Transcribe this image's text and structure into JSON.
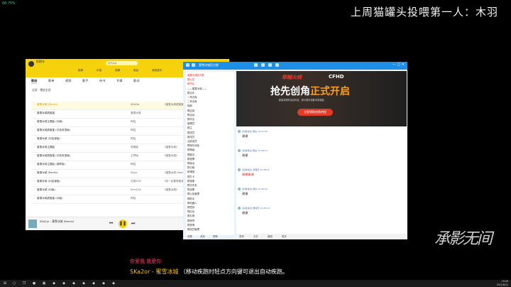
{
  "overlay": {
    "fps": "60 FPS",
    "banner": "上周猫罐头投喂第一人：木羽",
    "subtitle_line1": "你爱我 我爱你",
    "subtitle_song": "SKa2or - 蜜雪冰城",
    "subtitle_tip": "（移动疾跑时轻点方向键可退出自动疾跑。",
    "watermark": "承影无间"
  },
  "music": {
    "user": "斯斯咔",
    "search_placeholder": "蜜雪冰城",
    "nav": [
      "推荐",
      "乐馆",
      "视频",
      "电台",
      "我的音乐"
    ],
    "sidebar": [
      "我喜欢",
      "本地歌曲",
      "下载歌曲",
      "最近播放",
      "试听列表"
    ],
    "tabs": [
      "歌曲",
      "歌单",
      "视频",
      "歌手",
      "听书",
      "专辑",
      "歌词"
    ],
    "active_tab": "歌曲",
    "subtitle": "全部 · 播放全部",
    "rows": [
      {
        "song": "蜜雪冰城 (Remix)",
        "artist": "SKa2or",
        "album": "《蜜雪冰城甜蜜蜜》",
        "time": "02:40",
        "active": true
      },
      {
        "song": "蜜雪冰城甜蜜蜜",
        "artist": "蜜雪冰城",
        "album": "",
        "time": "00:58",
        "active": false
      },
      {
        "song": "蜜雪冰城主题曲 (DJ版)",
        "artist": "阿枯",
        "album": "",
        "time": "01:32",
        "active": false
      },
      {
        "song": "蜜雪冰城甜蜜蜜 (中英双语版)",
        "artist": "阿枯",
        "album": "",
        "time": "00:56",
        "active": false
      },
      {
        "song": "蜜雪冰城 (DJ加速版)",
        "artist": "阿枯",
        "album": "",
        "time": "01:04",
        "active": false
      },
      {
        "song": "蜜雪冰城主题曲",
        "artist": "张靓颖",
        "album": "《蜜雪冰城》",
        "time": "00:57",
        "active": false
      },
      {
        "song": "蜜雪冰城甜蜜蜜 (中英双语版)",
        "artist": "王梦瑶",
        "album": "《蜜雪冰城》",
        "time": "01:47",
        "active": false
      },
      {
        "song": "蜜雪冰城主题曲 (钢琴版)",
        "artist": "阿枯",
        "album": "",
        "time": "01:11",
        "active": false
      },
      {
        "song": "蜜雪冰城 (Remix)",
        "artist": "Seya",
        "album": "《蜜雪冰城 (Remix)》",
        "time": "02:22",
        "active": false
      },
      {
        "song": "蜜雪冰城 (DJ加速版)",
        "artist": "白菜SCH",
        "album": "《你一定要再爱我》",
        "time": "02:01",
        "active": false
      },
      {
        "song": "蜜雪冰城 (DJ版)",
        "artist": "Kim小Ss",
        "album": "《蜜雪冰城》",
        "time": "01:35",
        "active": false
      },
      {
        "song": "蜜雪冰城甜蜜蜜 (DJ版)",
        "artist": "阿枯",
        "album": "",
        "time": "00:58",
        "active": false
      }
    ],
    "player_text": "SKa2or - 蜜雪冰城 (Remix)",
    "play_icon": "pause-icon"
  },
  "chat": {
    "title": "蜜雪冰城官方群",
    "left_groups": [
      "蜜雪冰城官方群",
      "群公告",
      "精华区",
      "——蜜雪冰城——",
      "群文件",
      "一号仓库",
      "二号仓库",
      "相册",
      "群应用",
      "群活动",
      "群作业",
      "管理员",
      "群主",
      "群成员",
      "新成员",
      "活跃成员",
      "群精华消息",
      "群等级",
      "群匿名",
      "群投票",
      "群接龙",
      "群日程",
      "群课堂",
      "群打卡",
      "群相册",
      "群文件夹",
      "群设置",
      "群公告管理",
      "群助手",
      "群机器人",
      "群签到",
      "群红包",
      "群礼物",
      "群荣誉",
      "群表情",
      "群成员管理"
    ],
    "ad": {
      "logo": "穿越火线",
      "brand": "CFHD",
      "title_a": "抢先创角",
      "title_b": "正式开启",
      "sub": "新版本限时活动开启 · 参与即可领取丰厚奖励",
      "button": "立即领取创角特权"
    },
    "messages": [
      {
        "meta": "[系统消息] 群主 15:07:59",
        "text": "谢谢",
        "red": false
      },
      {
        "meta": "[系统消息] 群主 15:08:13",
        "text": "谢谢",
        "red": false
      },
      {
        "meta": "[系统消息] 管理员 15:08:21",
        "text": "谢谢谢谢",
        "red": true
      },
      {
        "meta": "[系统消息] 群主 15:09:02",
        "text": "谢谢",
        "red": false
      },
      {
        "meta": "[系统消息] 群成员 15:09:14",
        "text": "谢谢",
        "red": false
      }
    ],
    "bottom_tools": [
      "表情",
      "文件",
      "截图",
      "更多"
    ],
    "left_tools": [
      "设置",
      "消息",
      "群聊"
    ]
  },
  "taskbar": {
    "time": "15:09",
    "date": "2021/6/21"
  }
}
